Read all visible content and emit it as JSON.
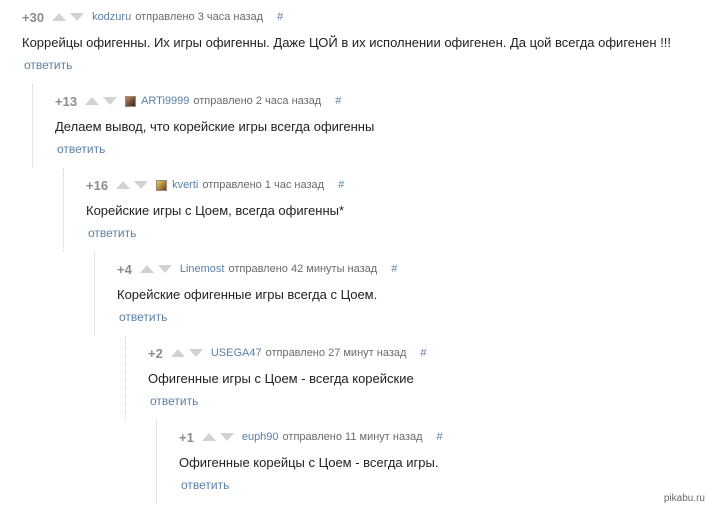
{
  "ui": {
    "sent_label": "отправлено",
    "reply_label": "ответить",
    "permalink_label": "#"
  },
  "comments": [
    {
      "score": "+30",
      "author": "kodzuru",
      "time": "3 часа назад",
      "text": "Коррейцы офигенны. Их игры офигенны. Даже ЦОЙ в их исполнении офигенен. Да цой всегда офигенен !!!",
      "avatar": null
    },
    {
      "score": "+13",
      "author": "ARTi9999",
      "time": "2 часа назад",
      "text": "Делаем вывод, что корейские игры всегда офигенны",
      "avatar": "avatar-icon"
    },
    {
      "score": "+16",
      "author": "kverti",
      "time": "1 час назад",
      "text": "Корейские игры с Цоем, всегда офигенны*",
      "avatar": "avatar-icon"
    },
    {
      "score": "+4",
      "author": "Linemost",
      "time": "42 минуты назад",
      "text": "Корейские офигенные игры всегда с Цоем.",
      "avatar": null
    },
    {
      "score": "+2",
      "author": "USEGA47",
      "time": "27 минут назад",
      "text": "Офигенные игры с Цоем - всегда корейские",
      "avatar": null
    },
    {
      "score": "+1",
      "author": "euph90",
      "time": "11 минут назад",
      "text": "Офигенные корейцы с Цоем - всегда игры.",
      "avatar": null
    }
  ],
  "watermark": "pikabu.ru",
  "colors": {
    "link": "#5a7fa6",
    "score": "#8c8c8c",
    "vote_arrow": "#cfd3d6",
    "text": "#222222",
    "thread_line": "#d3d3d3"
  }
}
